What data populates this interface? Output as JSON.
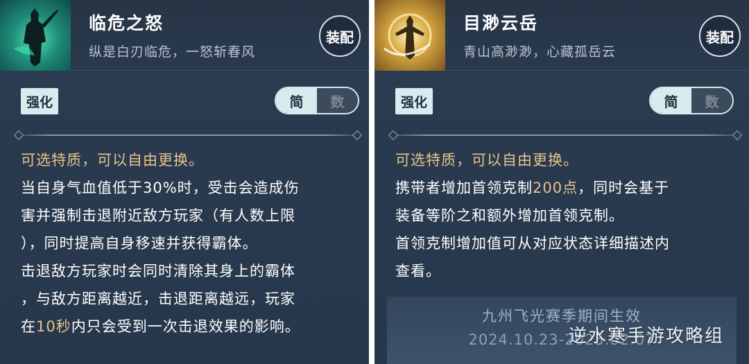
{
  "cards": [
    {
      "title": "临危之怒",
      "subtitle": "纵是白刃临危，一怒斩春风",
      "equip_label": "装配",
      "tag": "强化",
      "toggle": {
        "simple": "简",
        "numeric": "数",
        "selected": "简"
      },
      "trait_line": "可选特质，可以自由更换。",
      "lines": [
        "当自身气血值低于30%时，受击会造成伤",
        "害并强制击退附近敌方玩家（有人数上限",
        "），同时提高自身移速并获得霸体。",
        "击退敌方玩家时会同时清除其身上的霸体",
        "，与敌方距离越近，击退距离越远，玩家"
      ],
      "last_line_prefix": "在",
      "last_line_highlight": "10秒",
      "last_line_suffix": "内只会受到一次击退效果的影响。",
      "portrait_icon": "warrior-silhouette-icon",
      "portrait_color": "#2fbf95"
    },
    {
      "title": "目渺云岳",
      "subtitle": "青山高渺渺，心藏孤岳云",
      "equip_label": "装配",
      "tag": "强化",
      "toggle": {
        "simple": "简",
        "numeric": "数",
        "selected": "简"
      },
      "trait_line": "可选特质，可以自由更换。",
      "line1_prefix": "携带者增加首领克制",
      "line1_highlight": "200点",
      "line1_suffix": "，同时会基于",
      "lines": [
        "装备等阶之和额外增加首领克制。",
        "首领克制增加值可从对应状态详细描述内",
        "查看。"
      ],
      "season_title": "九州飞光赛季期间生效",
      "season_date": "2024.10.23-2025.02.07",
      "portrait_icon": "glowing-figure-icon",
      "portrait_color": "#e0b050"
    }
  ],
  "watermark": "逆水寒手游攻略组",
  "colors": {
    "highlight": "#e6c48a",
    "panel_bg": "#2a3a4e",
    "tag_bg": "#d8ecf0"
  }
}
